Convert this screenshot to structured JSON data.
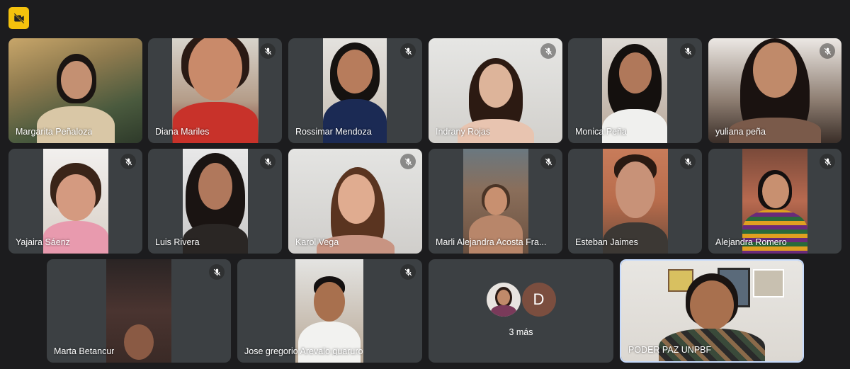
{
  "app": {
    "title": ""
  },
  "top_icon": {
    "name": "camera-off-icon"
  },
  "participants": [
    {
      "name": "Margarita Peñaloza"
    },
    {
      "name": "Diana Mariles"
    },
    {
      "name": "Rossimar Mendoza"
    },
    {
      "name": "Indrany Rojas"
    },
    {
      "name": "Monica Peña"
    },
    {
      "name": "yuliana peña"
    },
    {
      "name": "Yajaira Sáenz"
    },
    {
      "name": "Luis Rivera"
    },
    {
      "name": "Karol Vega"
    },
    {
      "name": "Marli Alejandra Acosta Fra..."
    },
    {
      "name": "Esteban Jaimes"
    },
    {
      "name": "Alejandra Romero"
    },
    {
      "name": "Marta Betancur"
    },
    {
      "name": "Jose gregorio Arevalo guaruro"
    },
    {
      "name": "PODER PAZ UNPBF"
    }
  ],
  "more": {
    "label": "3 más",
    "avatar_letter": "D"
  },
  "colors": {
    "background": "#1c1c1e",
    "tile": "#3c4043",
    "accent_yellow": "#f4c20d",
    "active_border": "#c6dafc"
  }
}
